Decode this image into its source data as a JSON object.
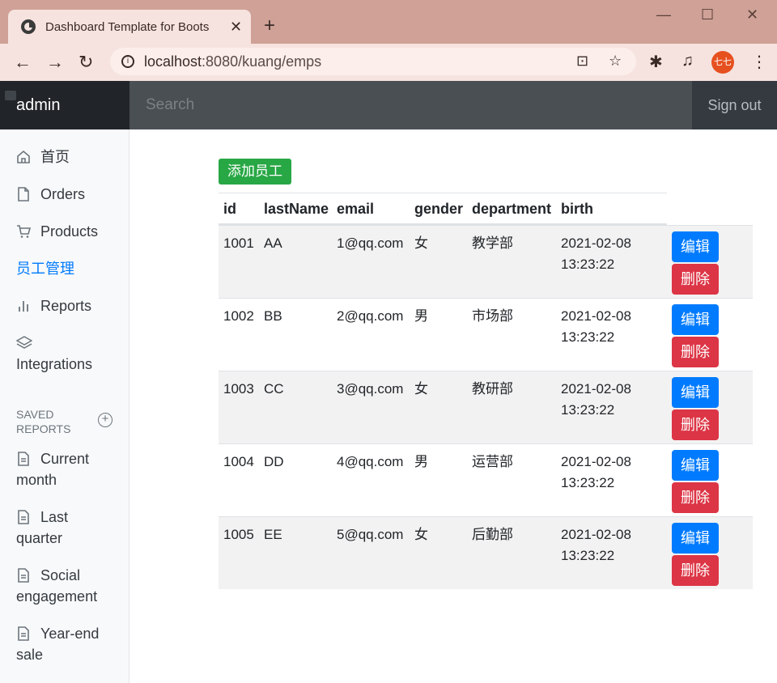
{
  "browser": {
    "tab_title": "Dashboard Template for Boots",
    "url_host": "localhost",
    "url_rest": ":8080/kuang/emps",
    "profile_initials": "七七"
  },
  "navbar": {
    "brand": "admin",
    "search_placeholder": "Search",
    "signout": "Sign out"
  },
  "sidebar": {
    "items": [
      {
        "label": "首页",
        "icon": "home-icon"
      },
      {
        "label": "Orders",
        "icon": "file-icon"
      },
      {
        "label": "Products",
        "icon": "shopping-cart-icon"
      },
      {
        "label": "员工管理",
        "icon": ""
      },
      {
        "label": "Reports",
        "icon": "bar-chart-icon"
      },
      {
        "label": "Integrations",
        "icon": "layers-icon"
      }
    ],
    "saved_heading_1": "SAVED",
    "saved_heading_2": "REPORTS",
    "saved": [
      {
        "line1": "Current",
        "line2": "month"
      },
      {
        "line1": "Last",
        "line2": "quarter"
      },
      {
        "line1": "Social",
        "line2": "engagement"
      },
      {
        "line1": "Year-end",
        "line2": "sale"
      }
    ]
  },
  "main": {
    "add_button": "添加员工",
    "columns": [
      "id",
      "lastName",
      "email",
      "gender",
      "department",
      "birth"
    ],
    "rows": [
      {
        "id": "1001",
        "lastName": "AA",
        "email": "1@qq.com",
        "gender": "女",
        "department": "教学部",
        "date": "2021-02-08",
        "time": "13:23:22"
      },
      {
        "id": "1002",
        "lastName": "BB",
        "email": "2@qq.com",
        "gender": "男",
        "department": "市场部",
        "date": "2021-02-08",
        "time": "13:23:22"
      },
      {
        "id": "1003",
        "lastName": "CC",
        "email": "3@qq.com",
        "gender": "女",
        "department": "教研部",
        "date": "2021-02-08",
        "time": "13:23:22"
      },
      {
        "id": "1004",
        "lastName": "DD",
        "email": "4@qq.com",
        "gender": "男",
        "department": "运营部",
        "date": "2021-02-08",
        "time": "13:23:22"
      },
      {
        "id": "1005",
        "lastName": "EE",
        "email": "5@qq.com",
        "gender": "女",
        "department": "后勤部",
        "date": "2021-02-08",
        "time": "13:23:22"
      }
    ],
    "edit_label": "编辑",
    "delete_label": "删除"
  },
  "colors": {
    "primary": "#007bff",
    "success": "#28a745",
    "danger": "#dc3545",
    "navbar": "#343a40"
  }
}
